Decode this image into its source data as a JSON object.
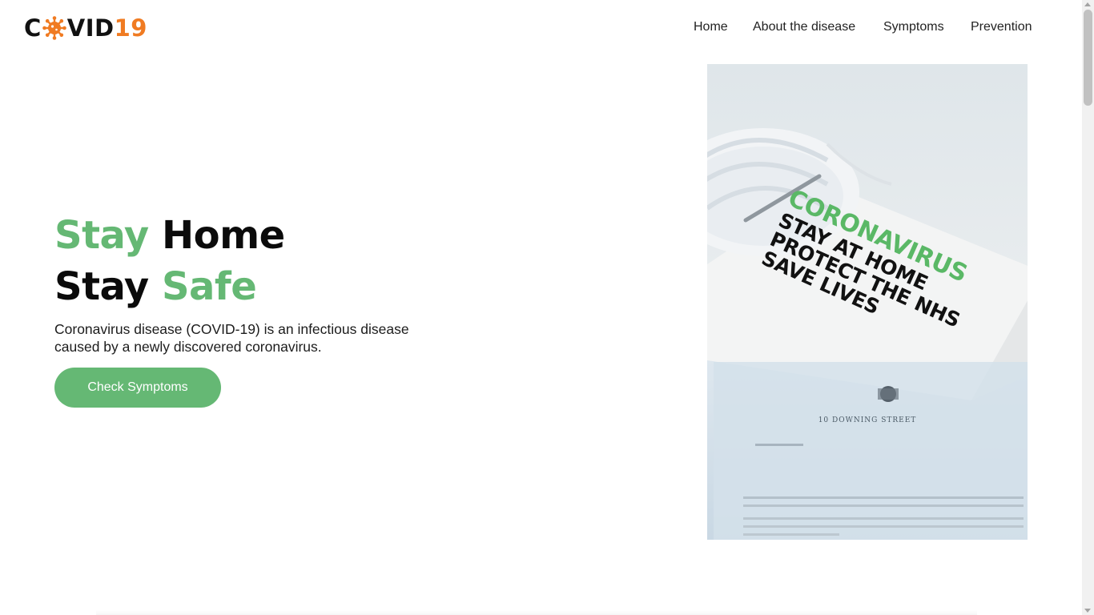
{
  "logo": {
    "c": "C",
    "icon": "virus-icon",
    "vid": "VID",
    "num": "19",
    "accent": "#f07b22"
  },
  "nav": {
    "items": [
      {
        "label": "Home"
      },
      {
        "label": "About the disease"
      },
      {
        "label": "Symptoms"
      },
      {
        "label": "Prevention"
      }
    ]
  },
  "hero": {
    "line1_green": "Stay",
    "line1_dark": "Home",
    "line2_dark": "Stay",
    "line2_green": "Safe",
    "description": "Coronavirus disease (COVID-19) is an infectious disease caused by a newly discovered coronavirus.",
    "button_label": "Check Symptoms",
    "accent": "#65b874"
  },
  "photo": {
    "leaflet_title": "CORONAVIRUS",
    "leaflet_line1": "STAY AT HOME",
    "leaflet_line2": "PROTECT THE NHS",
    "leaflet_line3": "SAVE LIVES",
    "letterhead": "10 DOWNING STREET"
  }
}
